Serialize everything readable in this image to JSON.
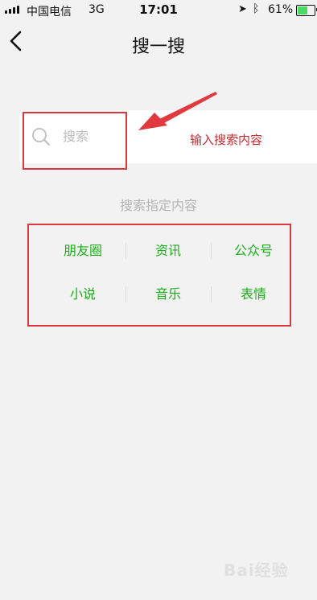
{
  "status_bar": {
    "carrier": "中国电信",
    "network": "3G",
    "time": "17:01",
    "battery": "61%",
    "location_icon": "location-arrow-icon",
    "bluetooth_icon": "bluetooth-icon"
  },
  "nav": {
    "title": "搜一搜",
    "back_icon": "chevron-left-icon"
  },
  "search": {
    "placeholder": "搜索",
    "icon": "search-icon"
  },
  "annotation": {
    "text": "输入搜索内容",
    "color": "#d9393e"
  },
  "section_label": "搜索指定内容",
  "categories": [
    [
      "朋友圈",
      "资讯",
      "公众号"
    ],
    [
      "小说",
      "音乐",
      "表情"
    ]
  ],
  "accent_color": "#1aad19",
  "watermark": "Bai经验"
}
